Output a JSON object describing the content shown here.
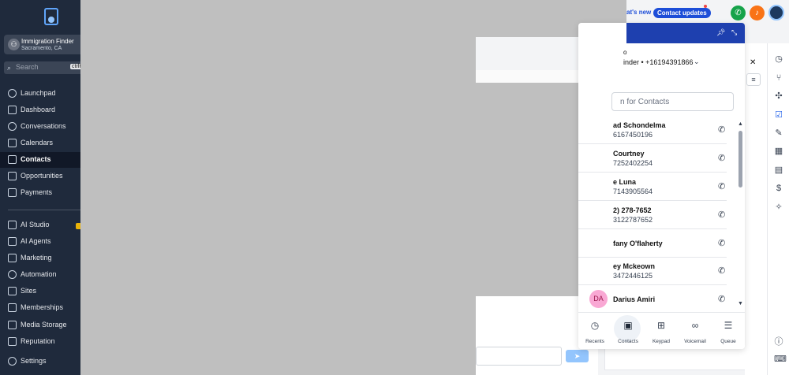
{
  "sidebar": {
    "account": {
      "name": "Immigration Finder",
      "location": "Sacramento, CA"
    },
    "search": {
      "placeholder": "Search",
      "shortcut": "ctrlK"
    },
    "items": [
      {
        "label": "Launchpad",
        "icon": "rocket-icon"
      },
      {
        "label": "Dashboard",
        "icon": "grid-icon"
      },
      {
        "label": "Conversations",
        "icon": "chat-icon"
      },
      {
        "label": "Calendars",
        "icon": "calendar-icon"
      },
      {
        "label": "Contacts",
        "icon": "contacts-icon",
        "active": true
      },
      {
        "label": "Opportunities",
        "icon": "funnel-icon"
      },
      {
        "label": "Payments",
        "icon": "payments-icon"
      },
      {
        "label": "AI Studio",
        "icon": "ai-studio-icon"
      },
      {
        "label": "AI Agents",
        "icon": "sparkle-icon"
      },
      {
        "label": "Marketing",
        "icon": "send-icon"
      },
      {
        "label": "Automation",
        "icon": "automation-icon"
      },
      {
        "label": "Sites",
        "icon": "sites-icon"
      },
      {
        "label": "Memberships",
        "icon": "memberships-icon"
      },
      {
        "label": "Media Storage",
        "icon": "image-icon"
      },
      {
        "label": "Reputation",
        "icon": "star-icon"
      },
      {
        "label": "Settings",
        "icon": "gear-icon"
      }
    ]
  },
  "topbar": {
    "whats_new": "at's new",
    "contact_updates": "Contact updates"
  },
  "phone": {
    "line_label": "o",
    "line_number": "inder • +16194391866",
    "search_placeholder": "n for Contacts",
    "contacts": [
      {
        "name": "ad Schondelma",
        "number": "6167450196"
      },
      {
        "name": "Courtney",
        "number": "7252402254"
      },
      {
        "name": "e Luna",
        "number": "7143905564"
      },
      {
        "name": "2) 278-7652",
        "number": "3122787652"
      },
      {
        "name": "fany O'flaherty",
        "number": ""
      },
      {
        "name": "ey Mckeown",
        "number": "3472446125"
      },
      {
        "name": "Darius Amiri",
        "number": "",
        "initials": "DA"
      }
    ],
    "bottom_nav": [
      {
        "label": "Recents",
        "icon": "clock-icon"
      },
      {
        "label": "Contacts",
        "icon": "contact-card-icon",
        "active": true
      },
      {
        "label": "Keypad",
        "icon": "keypad-icon"
      },
      {
        "label": "Voicemail",
        "icon": "voicemail-icon"
      },
      {
        "label": "Queue",
        "icon": "queue-icon"
      }
    ]
  },
  "colors": {
    "sidebar_bg": "#1f2a3c",
    "accent": "#1d4ed8",
    "overlay": "#bfbfbf"
  }
}
